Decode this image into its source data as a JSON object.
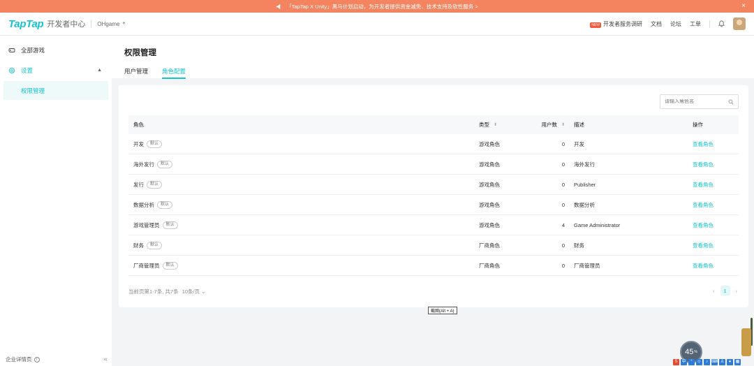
{
  "banner": {
    "text": "「TapTap X Unity」黑马计划启动，为开发者提供资金减免、技术支持及软性服务 >",
    "close": "×"
  },
  "topnav": {
    "logo": "TapTap",
    "logo_sub": "开发者中心",
    "game": "OHgame",
    "new_badge": "NEW",
    "survey": "开发者服务调研",
    "docs": "文档",
    "forum": "论坛",
    "ticket": "工单"
  },
  "sidebar": {
    "all_games": "全部游戏",
    "settings": "设置",
    "permissions": "权限管理",
    "footer": "企业详情页",
    "footer_info": "i",
    "collapse": "«"
  },
  "page": {
    "title": "权限管理",
    "tabs": [
      "用户管理",
      "角色配置"
    ]
  },
  "search": {
    "placeholder": "请输入角色名"
  },
  "table": {
    "headers": {
      "role": "角色",
      "type": "类型",
      "users": "用户数",
      "desc": "描述",
      "op": "操作"
    },
    "default_tag": "默认",
    "rows": [
      {
        "role": "开发",
        "type": "游戏角色",
        "users": "0",
        "desc": "开发",
        "op": "查看角色"
      },
      {
        "role": "海外发行",
        "type": "游戏角色",
        "users": "0",
        "desc": "海外发行",
        "op": "查看角色"
      },
      {
        "role": "发行",
        "type": "游戏角色",
        "users": "0",
        "desc": "Publisher",
        "op": "查看角色"
      },
      {
        "role": "数据分析",
        "type": "游戏角色",
        "users": "0",
        "desc": "数据分析",
        "op": "查看角色"
      },
      {
        "role": "游戏管理员",
        "type": "游戏角色",
        "users": "4",
        "desc": "Game Administrator",
        "op": "查看角色"
      },
      {
        "role": "财务",
        "type": "厂商角色",
        "users": "0",
        "desc": "财务",
        "op": "查看角色"
      },
      {
        "role": "厂商管理员",
        "type": "厂商角色",
        "users": "0",
        "desc": "厂商管理员",
        "op": "查看角色"
      }
    ]
  },
  "pagination": {
    "info": "当前页第1-7条, 共7条",
    "page_size": "10条/页",
    "current": "1",
    "prev": "‹",
    "next": "›"
  },
  "tooltip": "截图(Alt + A)",
  "overlay": {
    "speed_value": "45",
    "speed_unit": "%"
  },
  "colors": {
    "accent": "#15c5ce",
    "banner": "#f4845f"
  }
}
